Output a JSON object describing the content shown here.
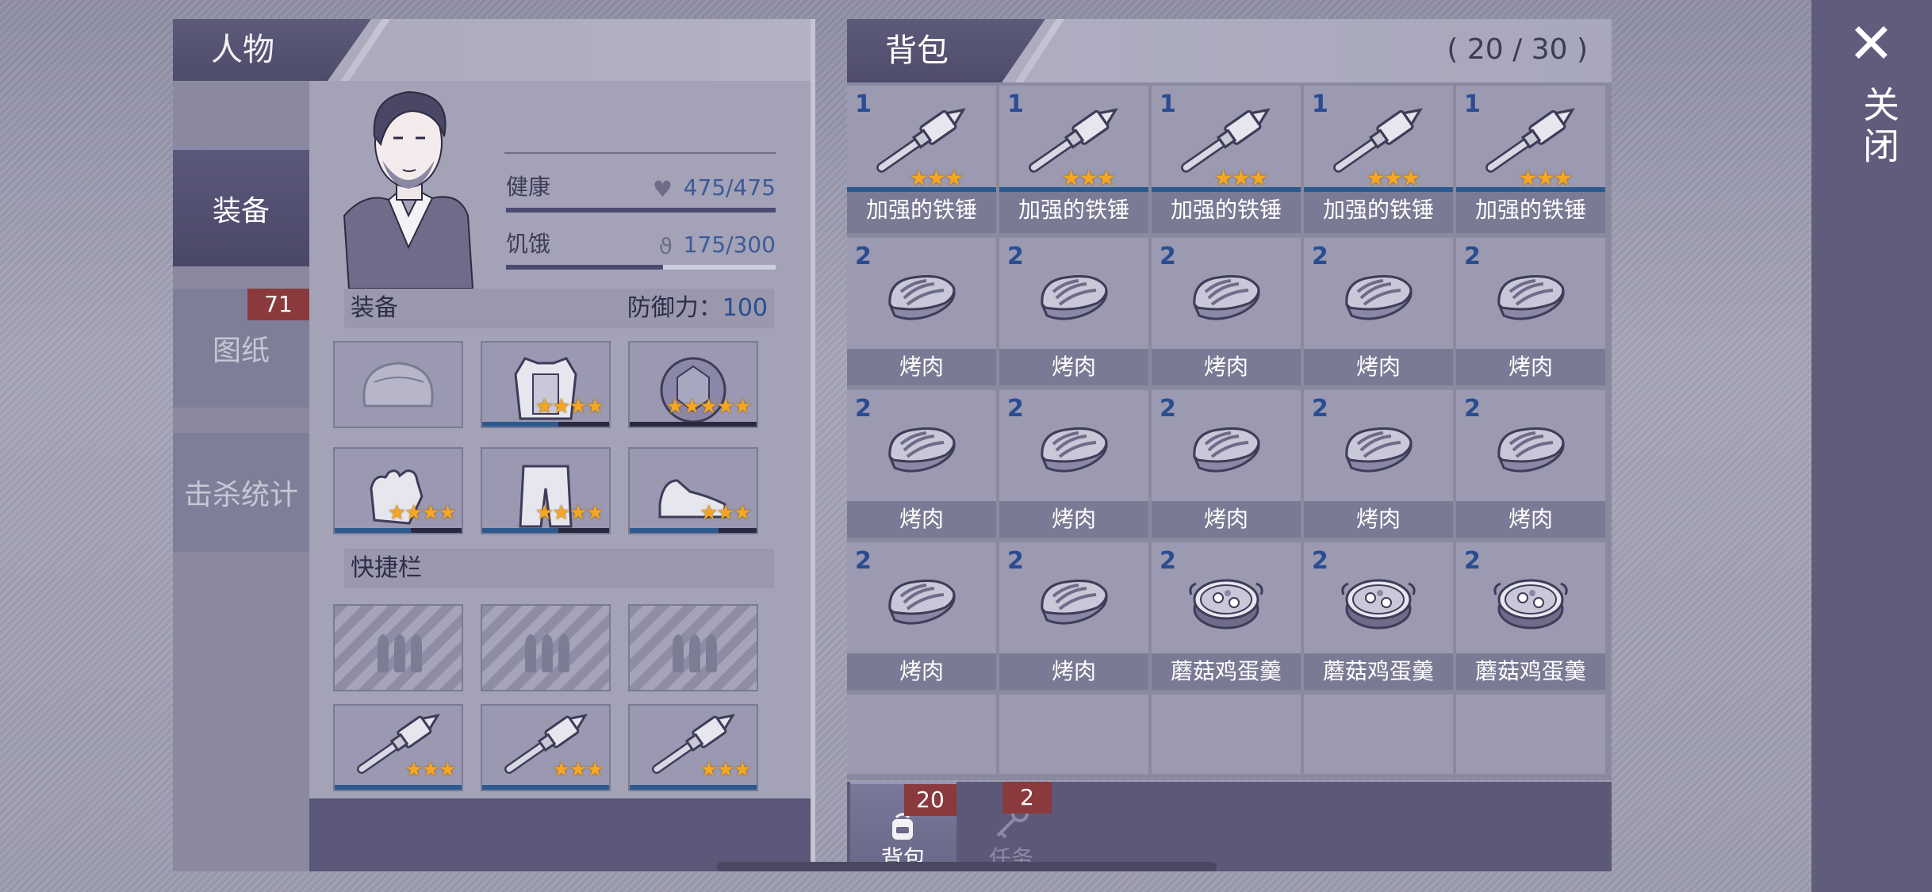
{
  "character": {
    "title": "人物",
    "tabs": [
      {
        "label": "装备",
        "active": true
      },
      {
        "label": "图纸",
        "badge": "71"
      },
      {
        "label": "击杀统计"
      }
    ],
    "stats": [
      {
        "label": "健康",
        "icon": "heart-icon",
        "value": "475/475",
        "fraction": 1.0
      },
      {
        "label": "饥饿",
        "icon": "stomach-icon",
        "value": "175/300",
        "fraction": 0.583
      }
    ],
    "equipment": {
      "title": "装备",
      "defense": "防御力：",
      "defense_value": "100",
      "slots": [
        {
          "icon": "beanie-icon",
          "stars": 0,
          "durability": 0
        },
        {
          "icon": "armor-vest-icon",
          "stars": 4,
          "durability": 0.6
        },
        {
          "icon": "turtle-shell-icon",
          "stars": 5,
          "durability": 0
        },
        {
          "icon": "gloves-icon",
          "stars": 4,
          "durability": 0.6
        },
        {
          "icon": "pants-icon",
          "stars": 4,
          "durability": 0.6
        },
        {
          "icon": "shoes-icon",
          "stars": 3,
          "durability": 0.7
        }
      ]
    },
    "quickbar": {
      "title": "快捷栏",
      "locked_icon": "ammo-lock-icon",
      "items": [
        {
          "icon": "iron-hammer-icon",
          "stars": 3
        },
        {
          "icon": "iron-hammer-icon",
          "stars": 3
        },
        {
          "icon": "iron-hammer-icon",
          "stars": 3
        }
      ]
    }
  },
  "backpack": {
    "title": "背包",
    "capacity": "( 20 / 30 )",
    "items": [
      {
        "qty": "1",
        "name": "加强的铁锤",
        "icon": "iron-hammer-icon",
        "stars": 3
      },
      {
        "qty": "1",
        "name": "加强的铁锤",
        "icon": "iron-hammer-icon",
        "stars": 3
      },
      {
        "qty": "1",
        "name": "加强的铁锤",
        "icon": "iron-hammer-icon",
        "stars": 3
      },
      {
        "qty": "1",
        "name": "加强的铁锤",
        "icon": "iron-hammer-icon",
        "stars": 3
      },
      {
        "qty": "1",
        "name": "加强的铁锤",
        "icon": "iron-hammer-icon",
        "stars": 3
      },
      {
        "qty": "2",
        "name": "烤肉",
        "icon": "grilled-meat-icon"
      },
      {
        "qty": "2",
        "name": "烤肉",
        "icon": "grilled-meat-icon"
      },
      {
        "qty": "2",
        "name": "烤肉",
        "icon": "grilled-meat-icon"
      },
      {
        "qty": "2",
        "name": "烤肉",
        "icon": "grilled-meat-icon"
      },
      {
        "qty": "2",
        "name": "烤肉",
        "icon": "grilled-meat-icon"
      },
      {
        "qty": "2",
        "name": "烤肉",
        "icon": "grilled-meat-icon"
      },
      {
        "qty": "2",
        "name": "烤肉",
        "icon": "grilled-meat-icon"
      },
      {
        "qty": "2",
        "name": "烤肉",
        "icon": "grilled-meat-icon"
      },
      {
        "qty": "2",
        "name": "烤肉",
        "icon": "grilled-meat-icon"
      },
      {
        "qty": "2",
        "name": "烤肉",
        "icon": "grilled-meat-icon"
      },
      {
        "qty": "2",
        "name": "烤肉",
        "icon": "grilled-meat-icon"
      },
      {
        "qty": "2",
        "name": "烤肉",
        "icon": "grilled-meat-icon"
      },
      {
        "qty": "2",
        "name": "蘑菇鸡蛋羹",
        "icon": "egg-custard-pot-icon"
      },
      {
        "qty": "2",
        "name": "蘑菇鸡蛋羹",
        "icon": "egg-custard-pot-icon"
      },
      {
        "qty": "2",
        "name": "蘑菇鸡蛋羹",
        "icon": "egg-custard-pot-icon"
      }
    ],
    "bottom_tabs": [
      {
        "label": "背包",
        "badge": "20",
        "icon": "backpack-icon",
        "active": true
      },
      {
        "label": "任务",
        "badge": "2",
        "icon": "key-icon",
        "active": false
      }
    ]
  },
  "close": {
    "label": "关闭",
    "icon": "close-icon"
  }
}
